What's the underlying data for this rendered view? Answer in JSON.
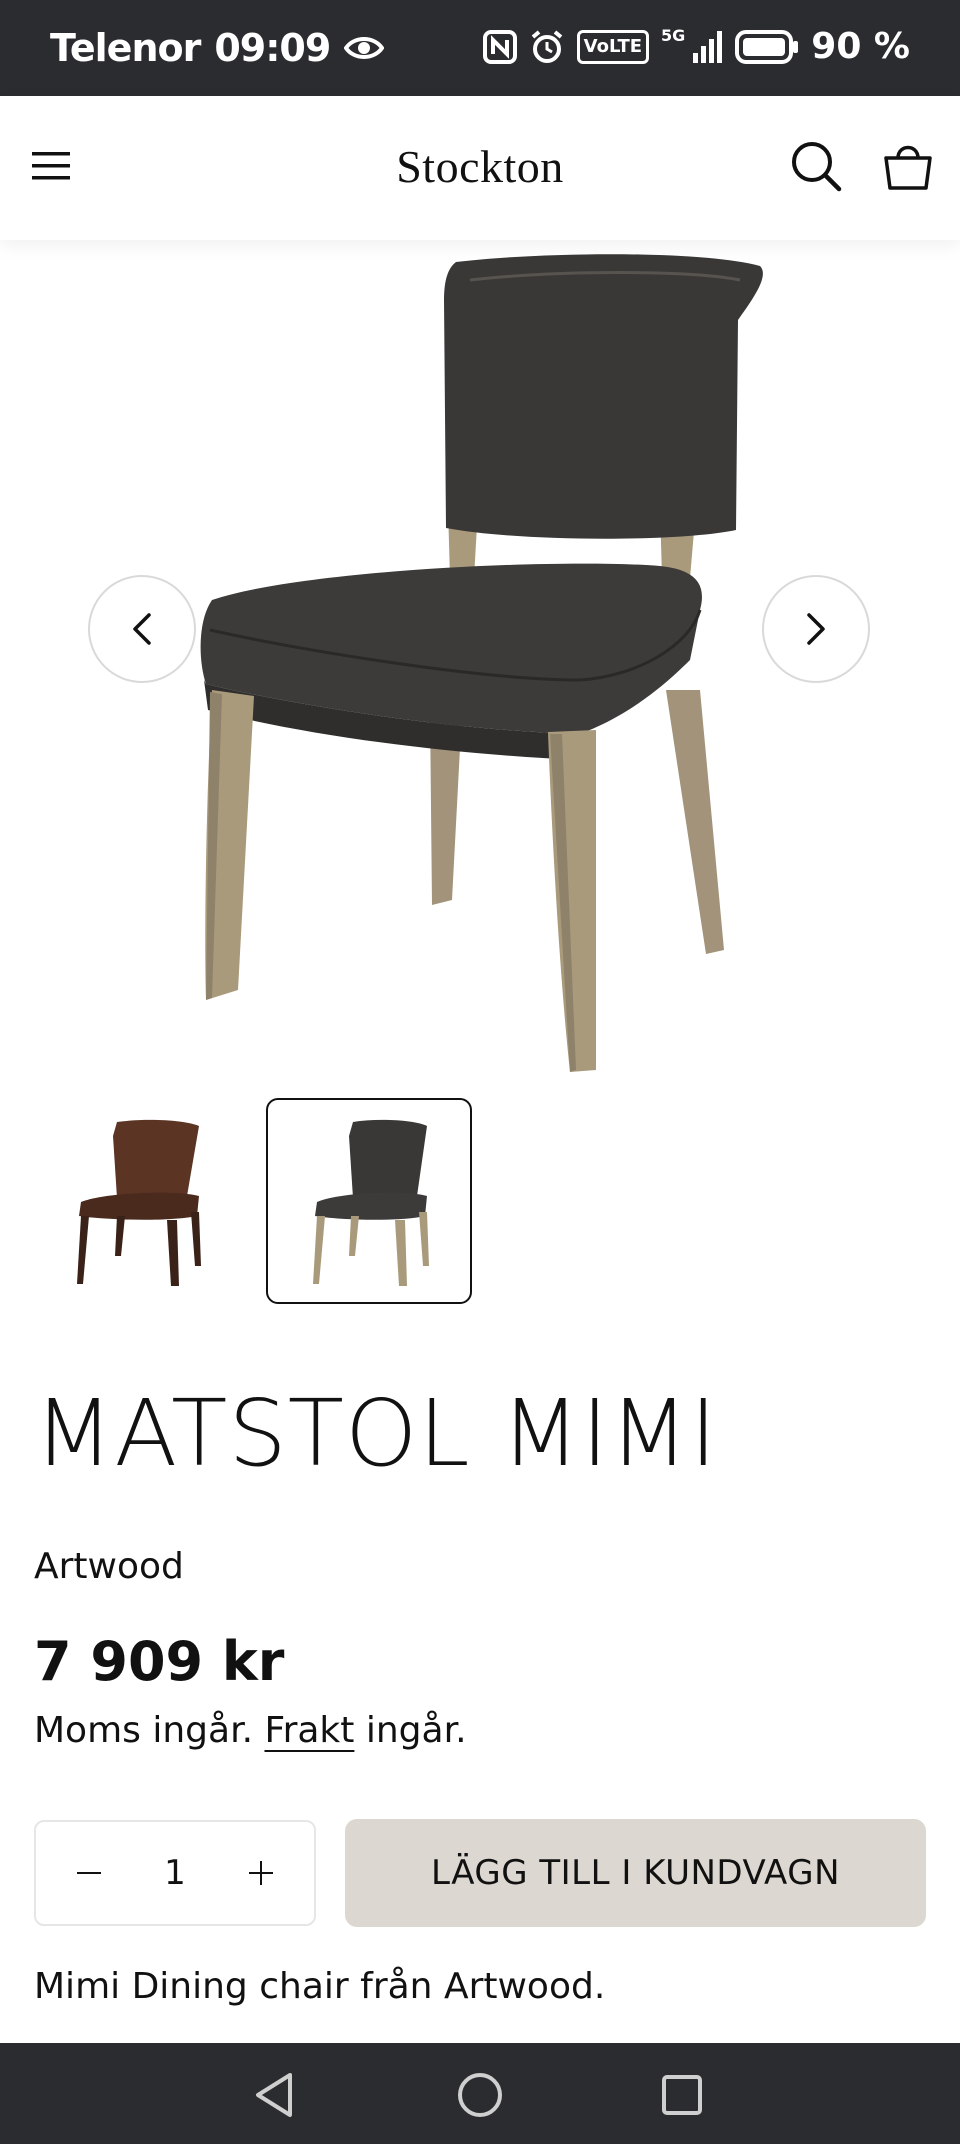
{
  "status_bar": {
    "carrier": "Telenor",
    "time": "09:09",
    "network": "5G",
    "volte": "VoLTE",
    "battery": "90 %"
  },
  "header": {
    "logo": "Stockton",
    "icons": [
      "menu-icon",
      "search-icon",
      "cart-icon"
    ]
  },
  "gallery": {
    "thumbnails": [
      {
        "color": "brown",
        "active": false
      },
      {
        "color": "dark-grey",
        "active": true
      }
    ],
    "colors": {
      "leather_dark": "#3a3836",
      "leather_brown": "#5b3424",
      "wood": "#a99a7c"
    }
  },
  "product": {
    "title": "MATSTOL MIMI",
    "vendor": "Artwood",
    "price": "7 909 kr",
    "tax_prefix": "Moms ingår.",
    "shipping_link": "Frakt",
    "tax_suffix": "ingår.",
    "quantity": "1",
    "add_to_cart": "LÄGG TILL I KUNDVAGN",
    "description": "Mimi Dining chair från Artwood."
  },
  "theme": {
    "button_bg": "#dcd7d0",
    "bar_bg": "#2b2c30"
  }
}
